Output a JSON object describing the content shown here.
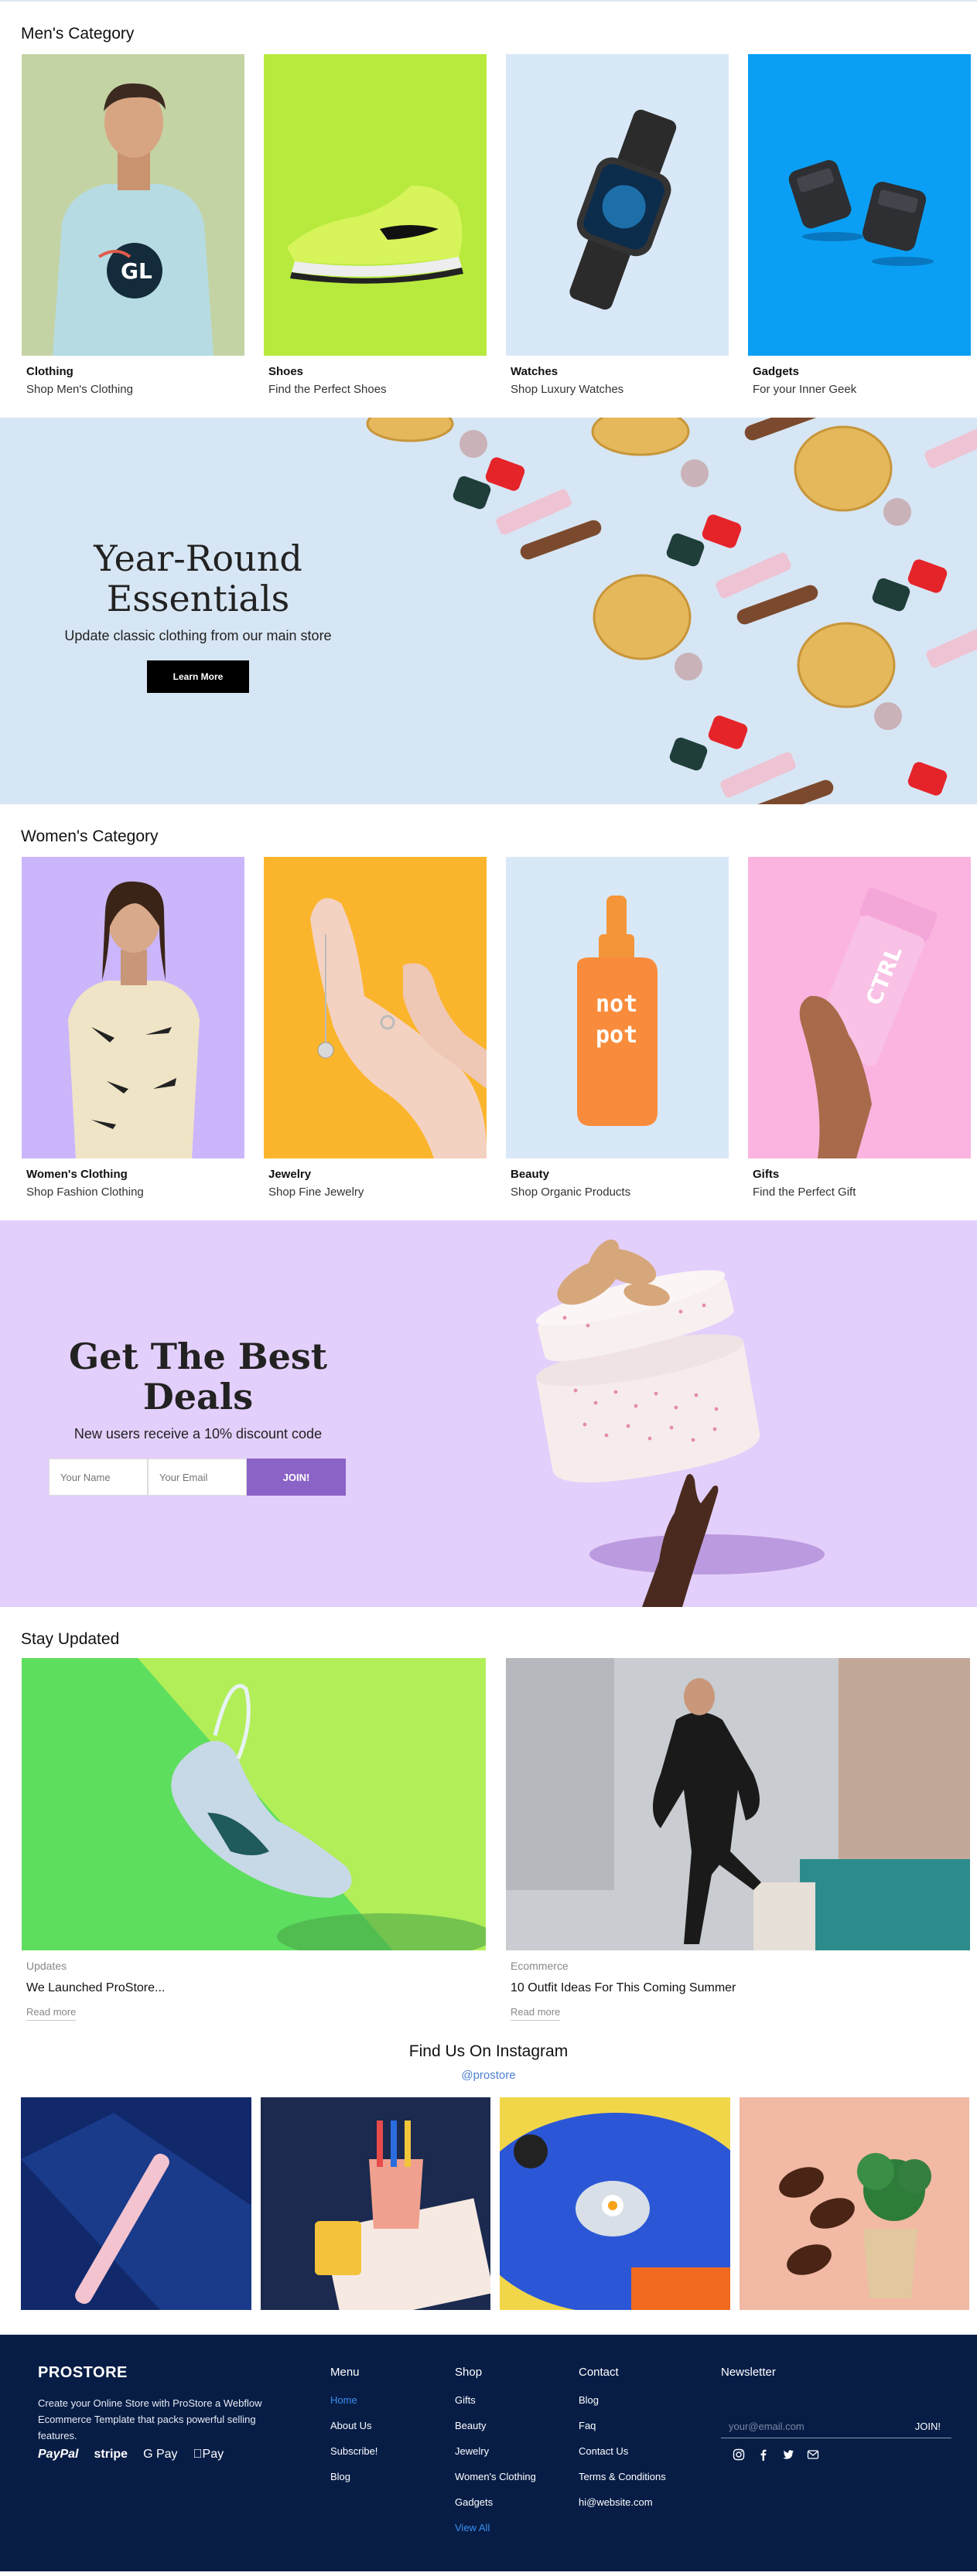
{
  "mens": {
    "title": "Men's Category",
    "items": [
      {
        "name": "Clothing",
        "sub": "Shop Men's Clothing"
      },
      {
        "name": "Shoes",
        "sub": "Find the Perfect Shoes"
      },
      {
        "name": "Watches",
        "sub": "Shop Luxury Watches"
      },
      {
        "name": "Gadgets",
        "sub": "For your Inner Geek"
      }
    ]
  },
  "hero": {
    "heading": "Year-Round Essentials",
    "sub": "Update classic clothing from our main store",
    "button": "Learn More"
  },
  "womens": {
    "title": "Women's Category",
    "items": [
      {
        "name": "Women's Clothing",
        "sub": "Shop Fashion Clothing"
      },
      {
        "name": "Jewelry",
        "sub": "Shop Fine Jewelry"
      },
      {
        "name": "Beauty",
        "sub": "Shop Organic Products"
      },
      {
        "name": "Gifts",
        "sub": "Find the Perfect Gift"
      }
    ]
  },
  "deals": {
    "heading": "Get The Best Deals",
    "sub": "New users receive a 10% discount code",
    "name_placeholder": "Your Name",
    "email_placeholder": "Your Email",
    "button": "JOIN!"
  },
  "updates": {
    "title": "Stay Updated",
    "posts": [
      {
        "tag": "Updates",
        "title": "We Launched ProStore...",
        "read": "Read more"
      },
      {
        "tag": "Ecommerce",
        "title": "10 Outfit Ideas For This Coming Summer",
        "read": "Read more"
      }
    ]
  },
  "instagram": {
    "title": "Find Us On Instagram",
    "handle": "@prostore"
  },
  "footer": {
    "logo": "PROSTORE",
    "description": "Create your Online Store with ProStore a Webflow Ecommerce Template that packs powerful selling features.",
    "payments": [
      "PayPal",
      "stripe",
      "G Pay",
      "Pay"
    ],
    "menu": {
      "title": "Menu",
      "links": [
        "Home",
        "About Us",
        "Subscribe!",
        "Blog"
      ]
    },
    "shop": {
      "title": "Shop",
      "links": [
        "Gifts",
        "Beauty",
        "Jewelry",
        "Women's Clothing",
        "Gadgets",
        "View All"
      ]
    },
    "contact": {
      "title": "Contact",
      "links": [
        "Blog",
        "Faq",
        "Contact Us",
        "Terms & Conditions",
        "hi@website.com"
      ]
    },
    "newsletter": {
      "title": "Newsletter",
      "placeholder": "your@email.com",
      "button": "JOIN!"
    }
  },
  "colors": {
    "hero_bg": "#d7e6f4",
    "deals_bg": "#e3cffb",
    "join_btn": "#8b63c6",
    "footer_bg": "#071d46",
    "link_active": "#3b8ff0"
  }
}
